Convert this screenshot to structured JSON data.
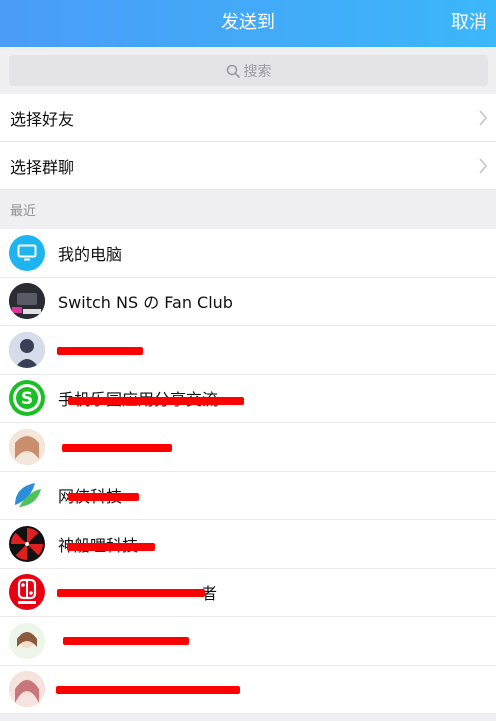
{
  "header": {
    "title": "发送到",
    "cancel": "取消"
  },
  "search": {
    "placeholder": "搜索"
  },
  "nav": [
    {
      "label": "选择好友"
    },
    {
      "label": "选择群聊"
    }
  ],
  "section": {
    "recent_label": "最近"
  },
  "recent": [
    {
      "name": "我的电脑",
      "icon": "computer-icon",
      "color": "#1eb4ef"
    },
    {
      "name": "Switch NS の Fan Club",
      "icon": "group-avatar",
      "color": "#333333"
    },
    {
      "name": "",
      "icon": "user-avatar",
      "color": "#9aa4c4"
    },
    {
      "name": "手机乐园应用分享交流",
      "icon": "s-logo-icon",
      "color": "#19c025"
    },
    {
      "name": "",
      "icon": "user-avatar",
      "color": "#e8c8b4"
    },
    {
      "name": "网侠科技",
      "icon": "leaf-logo-icon",
      "color": "#2a8ed8"
    },
    {
      "name": "神船哩科技",
      "icon": "umbrella-logo-icon",
      "color": "#111111"
    },
    {
      "name": "者",
      "icon": "nintendo-switch-icon",
      "color": "#e60012"
    },
    {
      "name": "",
      "icon": "user-avatar",
      "color": "#cfe3c8"
    },
    {
      "name": "",
      "icon": "user-avatar",
      "color": "#e6b7b0"
    }
  ]
}
